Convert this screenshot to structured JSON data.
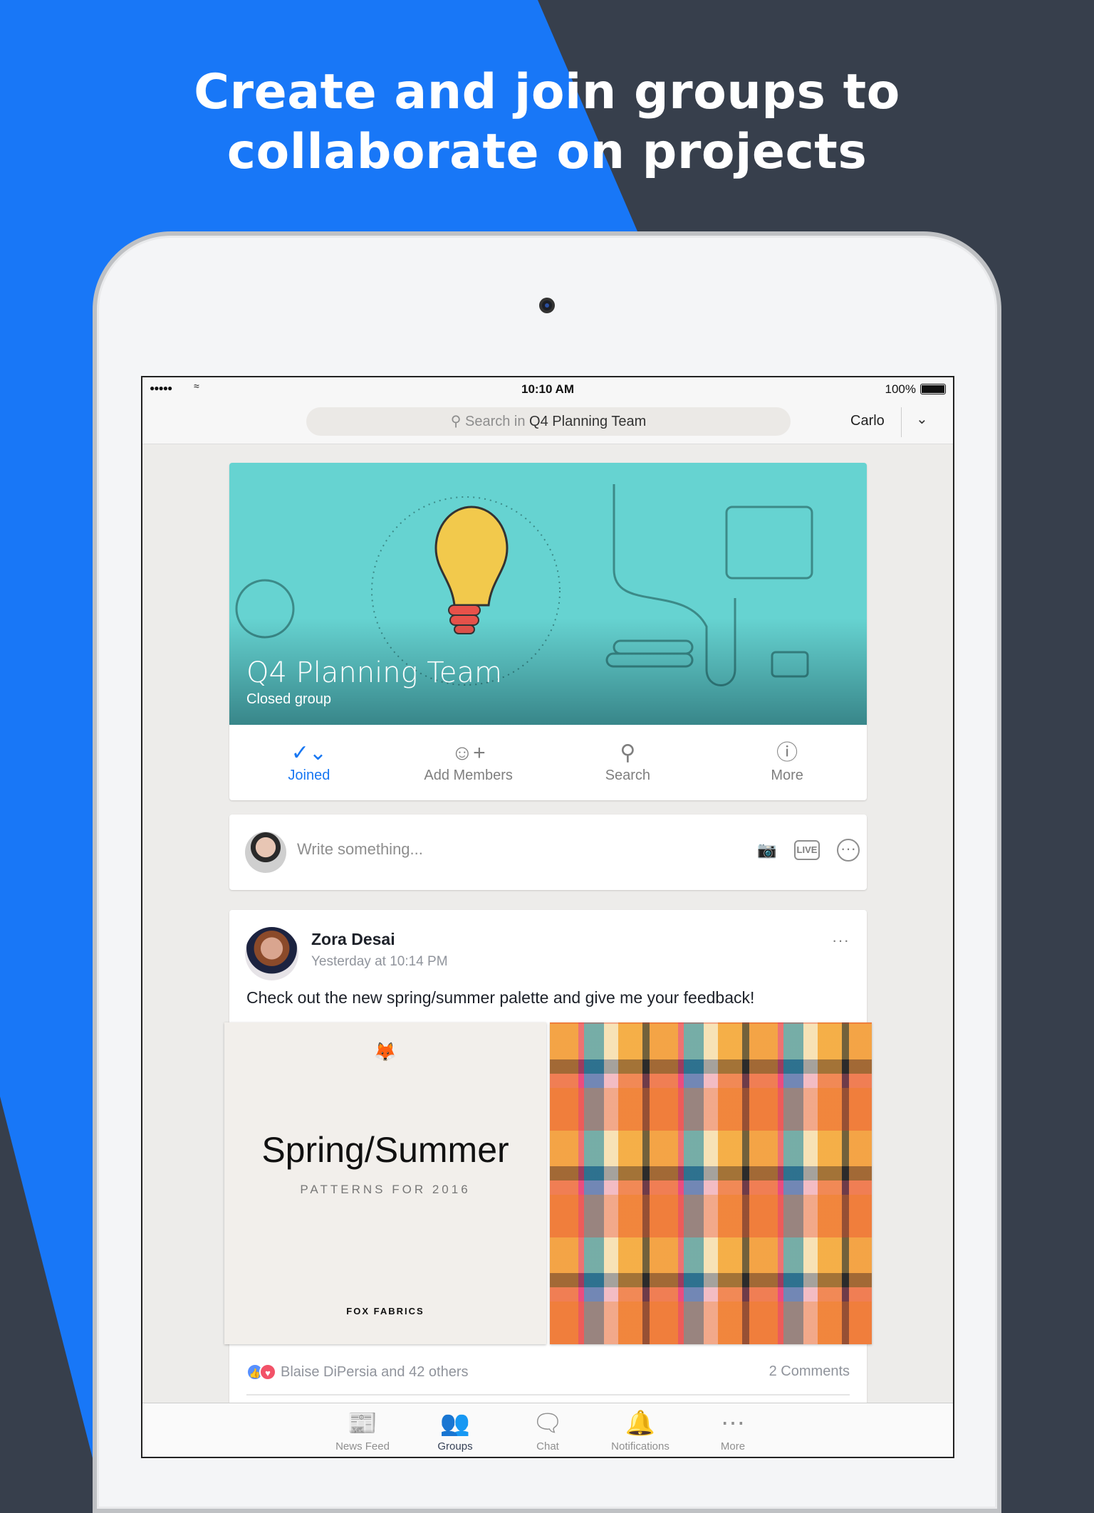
{
  "headline": {
    "line1": "Create and join groups to",
    "line2": "collaborate on projects"
  },
  "colors": {
    "accent": "#1877f7",
    "dark_bg": "#373f4c",
    "facebook_blue": "#1877f2",
    "cover_teal": "#66d3d1"
  },
  "status_bar": {
    "signal": "●●●●●",
    "time": "10:10 AM",
    "battery_pct": "100%"
  },
  "nav": {
    "search_prefix": "Search in",
    "search_group": "Q4 Planning Team",
    "user": "Carlo"
  },
  "group": {
    "name": "Q4 Planning Team",
    "privacy": "Closed group",
    "actions": [
      {
        "label": "Joined",
        "icon": "check-circle-icon",
        "active": true
      },
      {
        "label": "Add Members",
        "icon": "add-person-icon"
      },
      {
        "label": "Search",
        "icon": "search-icon"
      },
      {
        "label": "More",
        "icon": "info-icon"
      }
    ]
  },
  "composer": {
    "placeholder": "Write something...",
    "icons": [
      "camera-icon",
      "live-icon",
      "more-icon"
    ],
    "live_label": "LIVE"
  },
  "post": {
    "author": "Zora Desai",
    "time": "Yesterday at 10:14 PM",
    "text": "Check out the new spring/summer palette and give me your feedback!",
    "photo_left": {
      "title": "Spring/Summer",
      "subtitle": "PATTERNS FOR 2016",
      "brand": "FOX FABRICS"
    },
    "reactions_text": "Blaise DiPersia and 42 others",
    "comments": "2 Comments"
  },
  "tabbar": [
    {
      "label": "News Feed",
      "icon": "news-feed-icon"
    },
    {
      "label": "Groups",
      "icon": "groups-icon",
      "active": true
    },
    {
      "label": "Chat",
      "icon": "chat-icon"
    },
    {
      "label": "Notifications",
      "icon": "bell-icon"
    },
    {
      "label": "More",
      "icon": "more-icon"
    }
  ]
}
